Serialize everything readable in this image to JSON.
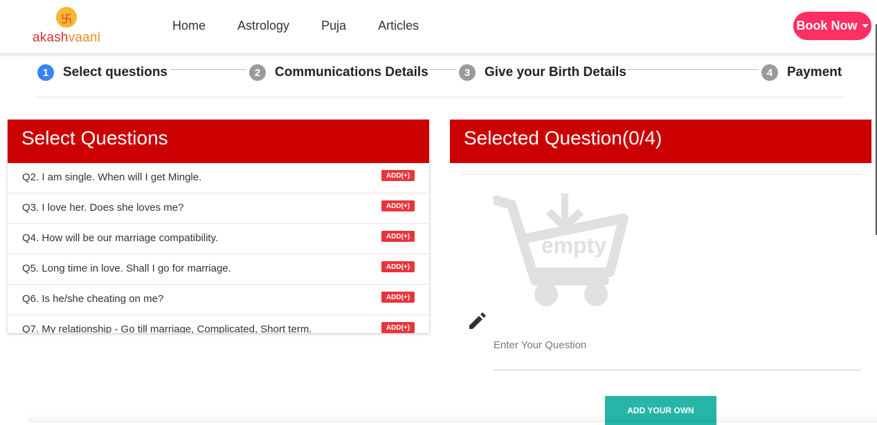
{
  "brand": {
    "mark": "卐",
    "name_part1": "akash",
    "name_part2": "vaani"
  },
  "nav": {
    "items": [
      "Home",
      "Astrology",
      "Puja",
      "Articles"
    ]
  },
  "book_button": {
    "label": "Book Now"
  },
  "steps": [
    {
      "num": "1",
      "label": "Select questions",
      "active": true
    },
    {
      "num": "2",
      "label": "Communications Details",
      "active": false
    },
    {
      "num": "3",
      "label": "Give your Birth Details",
      "active": false
    },
    {
      "num": "4",
      "label": "Payment",
      "active": false
    }
  ],
  "select_panel": {
    "title": "Select Questions",
    "add_label": "ADD(+)",
    "questions": [
      "Q2. I am single. When will I get Mingle.",
      "Q3. I love her. Does she loves me?",
      "Q4. How will be our marriage compatibility.",
      "Q5. Long time in love. Shall I go for marriage.",
      "Q6. Is he/she cheating on me?",
      "Q7. My relationship - Go till marriage, Complicated, Short term."
    ]
  },
  "selected_panel": {
    "title": "Selected Question(0/4)",
    "empty_label": "empty",
    "input_placeholder": "Enter Your Question",
    "add_own_label": "ADD YOUR OWN"
  },
  "colors": {
    "header_red": "#cc0000",
    "book_pink": "#ff2e63",
    "add_red": "#e8353a",
    "teal": "#26b5a6",
    "active_step": "#3b82f6"
  }
}
